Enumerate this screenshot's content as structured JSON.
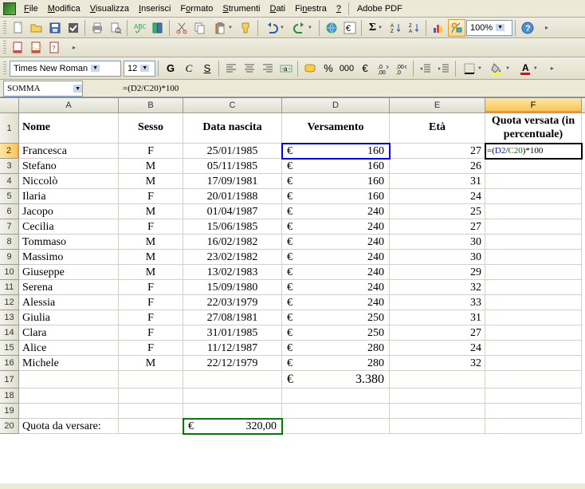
{
  "menu": {
    "items": [
      {
        "u": "F",
        "rest": "ile"
      },
      {
        "u": "M",
        "rest": "odifica"
      },
      {
        "u": "V",
        "rest": "isualizza"
      },
      {
        "u": "I",
        "rest": "nserisci"
      },
      {
        "u": "F",
        "rest": "ormato",
        "pre": "F",
        "under": "o",
        "tail": "rmato"
      },
      {
        "u": "S",
        "rest": "trumenti"
      },
      {
        "u": "D",
        "rest": "ati"
      },
      {
        "u": "F",
        "rest": "inestra",
        "pre": "Fi",
        "under": "n",
        "tail": "estra"
      },
      {
        "u": "?",
        "rest": ""
      }
    ],
    "adobe": "Adobe PDF"
  },
  "toolbar": {
    "zoom": "100%"
  },
  "fontbox": {
    "font": "Times New Roman",
    "size": "12"
  },
  "formulabar": {
    "name": "SOMMA",
    "formula_prefix": "=(",
    "formula_d2": "D2",
    "formula_slash": "/",
    "formula_c20": "C20",
    "formula_suffix": ")*100"
  },
  "columns": [
    "A",
    "B",
    "C",
    "D",
    "E",
    "F"
  ],
  "headers": {
    "A": "Nome",
    "B": "Sesso",
    "C": "Data nascita",
    "D": "Versamento",
    "E": "Età",
    "F": "Quota versata (in percentuale)"
  },
  "rows": [
    {
      "n": 2,
      "A": "Francesca",
      "B": "F",
      "C": "25/01/1985",
      "Damt": "160",
      "E": "27",
      "F": "=(D2/C20)*100"
    },
    {
      "n": 3,
      "A": "Stefano",
      "B": "M",
      "C": "05/11/1985",
      "Damt": "160",
      "E": "26"
    },
    {
      "n": 4,
      "A": "Niccolò",
      "B": "M",
      "C": "17/09/1981",
      "Damt": "160",
      "E": "31"
    },
    {
      "n": 5,
      "A": "Ilaria",
      "B": "F",
      "C": "20/01/1988",
      "Damt": "160",
      "E": "24"
    },
    {
      "n": 6,
      "A": "Jacopo",
      "B": "M",
      "C": "01/04/1987",
      "Damt": "240",
      "E": "25"
    },
    {
      "n": 7,
      "A": "Cecilia",
      "B": "F",
      "C": "15/06/1985",
      "Damt": "240",
      "E": "27"
    },
    {
      "n": 8,
      "A": "Tommaso",
      "B": "M",
      "C": "16/02/1982",
      "Damt": "240",
      "E": "30"
    },
    {
      "n": 9,
      "A": "Massimo",
      "B": "M",
      "C": "23/02/1982",
      "Damt": "240",
      "E": "30"
    },
    {
      "n": 10,
      "A": "Giuseppe",
      "B": "M",
      "C": "13/02/1983",
      "Damt": "240",
      "E": "29"
    },
    {
      "n": 11,
      "A": "Serena",
      "B": "F",
      "C": "15/09/1980",
      "Damt": "240",
      "E": "32"
    },
    {
      "n": 12,
      "A": "Alessia",
      "B": "F",
      "C": "22/03/1979",
      "Damt": "240",
      "E": "33"
    },
    {
      "n": 13,
      "A": "Giulia",
      "B": "F",
      "C": "27/08/1981",
      "Damt": "250",
      "E": "31"
    },
    {
      "n": 14,
      "A": "Clara",
      "B": "F",
      "C": "31/01/1985",
      "Damt": "250",
      "E": "27"
    },
    {
      "n": 15,
      "A": "Alice",
      "B": "F",
      "C": "11/12/1987",
      "Damt": "280",
      "E": "24"
    },
    {
      "n": 16,
      "A": "Michele",
      "B": "M",
      "C": "22/12/1979",
      "Damt": "280",
      "E": "32"
    }
  ],
  "total_row": {
    "n": 17,
    "Damt": "3.380"
  },
  "empty_rows": [
    18,
    19
  ],
  "quota_row": {
    "n": 20,
    "label": "Quota da versare:",
    "amt": "320,00"
  },
  "currency": "€",
  "chart_data": {
    "type": "table",
    "title": "",
    "columns": [
      "Nome",
      "Sesso",
      "Data nascita",
      "Versamento",
      "Età",
      "Quota versata (in percentuale)"
    ],
    "records": [
      [
        "Francesca",
        "F",
        "25/01/1985",
        160,
        27,
        null
      ],
      [
        "Stefano",
        "M",
        "05/11/1985",
        160,
        26,
        null
      ],
      [
        "Niccolò",
        "M",
        "17/09/1981",
        160,
        31,
        null
      ],
      [
        "Ilaria",
        "F",
        "20/01/1988",
        160,
        24,
        null
      ],
      [
        "Jacopo",
        "M",
        "01/04/1987",
        240,
        25,
        null
      ],
      [
        "Cecilia",
        "F",
        "15/06/1985",
        240,
        27,
        null
      ],
      [
        "Tommaso",
        "M",
        "16/02/1982",
        240,
        30,
        null
      ],
      [
        "Massimo",
        "M",
        "23/02/1982",
        240,
        30,
        null
      ],
      [
        "Giuseppe",
        "M",
        "13/02/1983",
        240,
        29,
        null
      ],
      [
        "Serena",
        "F",
        "15/09/1980",
        240,
        32,
        null
      ],
      [
        "Alessia",
        "F",
        "22/03/1979",
        240,
        33,
        null
      ],
      [
        "Giulia",
        "F",
        "27/08/1981",
        250,
        31,
        null
      ],
      [
        "Clara",
        "F",
        "31/01/1985",
        250,
        27,
        null
      ],
      [
        "Alice",
        "F",
        "11/12/1987",
        280,
        24,
        null
      ],
      [
        "Michele",
        "M",
        "22/12/1979",
        280,
        32,
        null
      ]
    ],
    "total_versamento": 3380,
    "quota_da_versare": 320.0,
    "formula_F2": "=(D2/C20)*100"
  }
}
